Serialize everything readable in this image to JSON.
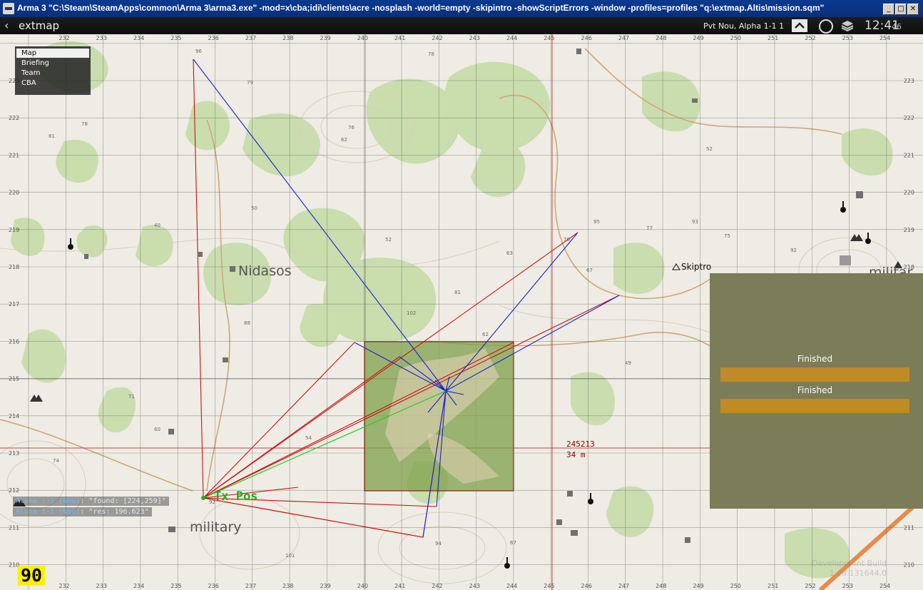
{
  "window": {
    "title": "Arma 3 \"C:\\Steam\\SteamApps\\common\\Arma 3\\arma3.exe\" -mod=x\\cba;idi\\clients\\acre -nosplash -world=empty -skipintro -showScriptErrors -window -profiles=profiles \"q:\\extmap.Altis\\mission.sqm\"",
    "buttons": [
      "_",
      "□",
      "✕"
    ]
  },
  "topbar": {
    "back_icon": "‹",
    "title": "extmap",
    "player": "Pvt Nou, Alpha 1-1 1",
    "clock": "12:41",
    "clock_seconds": "46"
  },
  "menu": {
    "items": [
      "Map",
      "Briefing",
      "Team",
      "CBA"
    ],
    "active": "Map"
  },
  "map": {
    "x_labels": [
      "232",
      "233",
      "234",
      "235",
      "236",
      "237",
      "238",
      "239",
      "240",
      "241",
      "242",
      "243",
      "244",
      "245",
      "246",
      "247",
      "248",
      "249",
      "250",
      "251",
      "252",
      "253",
      "254"
    ],
    "y_labels": [
      "223",
      "222",
      "221",
      "220",
      "219",
      "218",
      "217",
      "216",
      "215",
      "214",
      "213",
      "212",
      "211",
      "210"
    ],
    "towns": [
      "Nidasos",
      "military",
      "militar"
    ],
    "tx_label": "Tx Pos",
    "skiptro_label": "Skiptro",
    "marker_grid": "245213",
    "marker_distance": "34 m",
    "heights": [
      "96",
      "79",
      "78",
      "76",
      "81",
      "62",
      "50",
      "40",
      "52",
      "63",
      "81",
      "102",
      "62",
      "49",
      "60",
      "54",
      "74",
      "92",
      "101",
      "94",
      "67",
      "88",
      "77",
      "93",
      "75",
      "92",
      "52",
      "95",
      "67",
      "70",
      "71",
      "78"
    ]
  },
  "chat": [
    {
      "who": "Alpha 1-1 (Nou)",
      "text": ": \"found: [224,259]\""
    },
    {
      "who": "Alpha 1-1 (Nou)",
      "text": ": \"res: 196.623\""
    }
  ],
  "status_panel": {
    "bg": "#7a7d58",
    "bars": [
      {
        "label": "Finished",
        "progress": 1.0
      },
      {
        "label": "Finished",
        "progress": 1.0
      }
    ],
    "bar_color": "#c08a25"
  },
  "fps": "90",
  "watermark": [
    "Development Build",
    "1.48.131644.0"
  ]
}
